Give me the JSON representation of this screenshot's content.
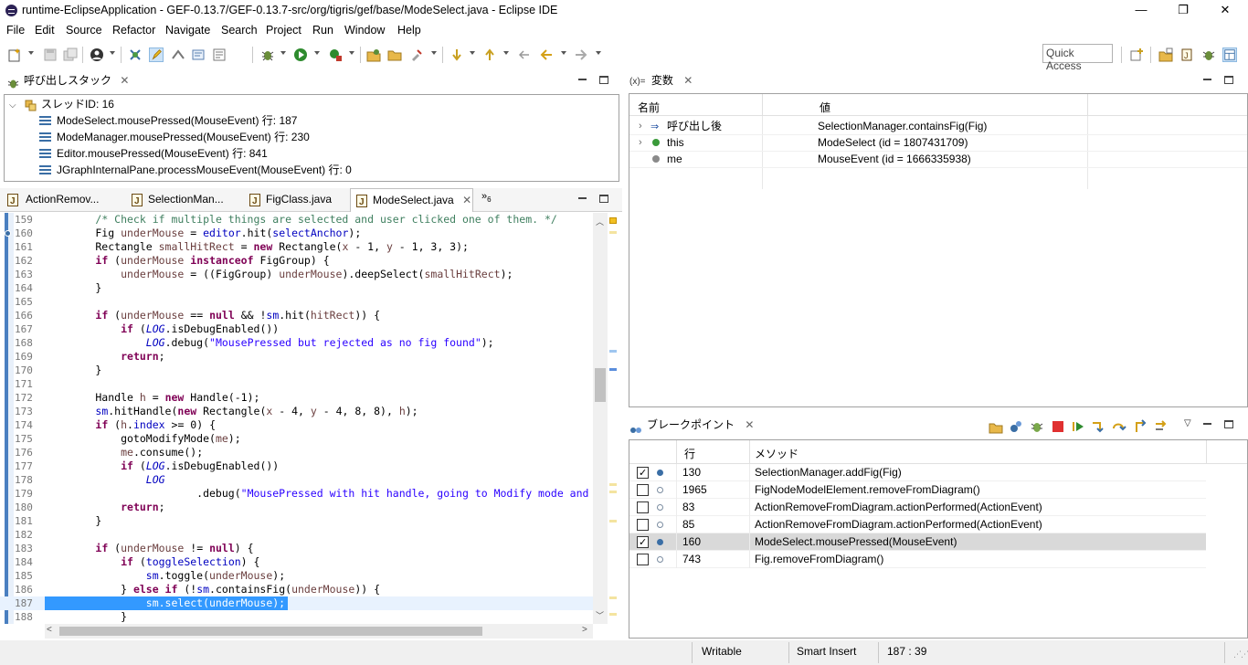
{
  "window": {
    "title": "runtime-EclipseApplication - GEF-0.13.7/GEF-0.13.7-src/org/tigris/gef/base/ModeSelect.java - Eclipse IDE",
    "minimize": "—",
    "restore": "❐",
    "close": "✕"
  },
  "menu": [
    "File",
    "Edit",
    "Source",
    "Refactor",
    "Navigate",
    "Search",
    "Project",
    "Run",
    "Window",
    "Help"
  ],
  "toolbar": {
    "quick_access_placeholder": "Quick Access"
  },
  "callstack": {
    "tab_label": "呼び出しスタック",
    "thread": "スレッドID: 16",
    "frames": [
      "ModeSelect.mousePressed(MouseEvent) 行: 187",
      "ModeManager.mousePressed(MouseEvent) 行: 230",
      "Editor.mousePressed(MouseEvent) 行: 841",
      "JGraphInternalPane.processMouseEvent(MouseEvent) 行: 0"
    ]
  },
  "editor": {
    "tabs": [
      "ActionRemov...",
      "SelectionMan...",
      "FigClass.java",
      "ModeSelect.java"
    ],
    "overflow_count": "6",
    "current_line": 187
  },
  "variables": {
    "tab_prefix": "(x)=",
    "tab_label": "変数",
    "col_name": "名前",
    "col_value": "値",
    "rows": [
      {
        "name": "呼び出し後",
        "value": "SelectionManager.containsFig(Fig)"
      },
      {
        "name": "this",
        "value": "ModeSelect (id = 1807431709)"
      },
      {
        "name": "me",
        "value": "MouseEvent (id = 1666335938)"
      }
    ]
  },
  "breakpoints": {
    "tab_label": "ブレークポイント",
    "col_line": "行",
    "col_method": "メソッド",
    "rows": [
      {
        "checked": true,
        "line": "130",
        "method": "SelectionManager.addFig(Fig)"
      },
      {
        "checked": false,
        "line": "1965",
        "method": "FigNodeModelElement.removeFromDiagram()"
      },
      {
        "checked": false,
        "line": "83",
        "method": "ActionRemoveFromDiagram.actionPerformed(ActionEvent)"
      },
      {
        "checked": false,
        "line": "85",
        "method": "ActionRemoveFromDiagram.actionPerformed(ActionEvent)"
      },
      {
        "checked": true,
        "line": "160",
        "method": "ModeSelect.mousePressed(MouseEvent)"
      },
      {
        "checked": false,
        "line": "743",
        "method": "Fig.removeFromDiagram()"
      }
    ]
  },
  "status": {
    "writable": "Writable",
    "insert_mode": "Smart Insert",
    "position": "187 : 39"
  },
  "colors": {
    "selection": "#3399ff",
    "keyword": "#7f0055",
    "comment": "#3f7f5f",
    "string": "#2a00ff",
    "field": "#0000c0"
  }
}
